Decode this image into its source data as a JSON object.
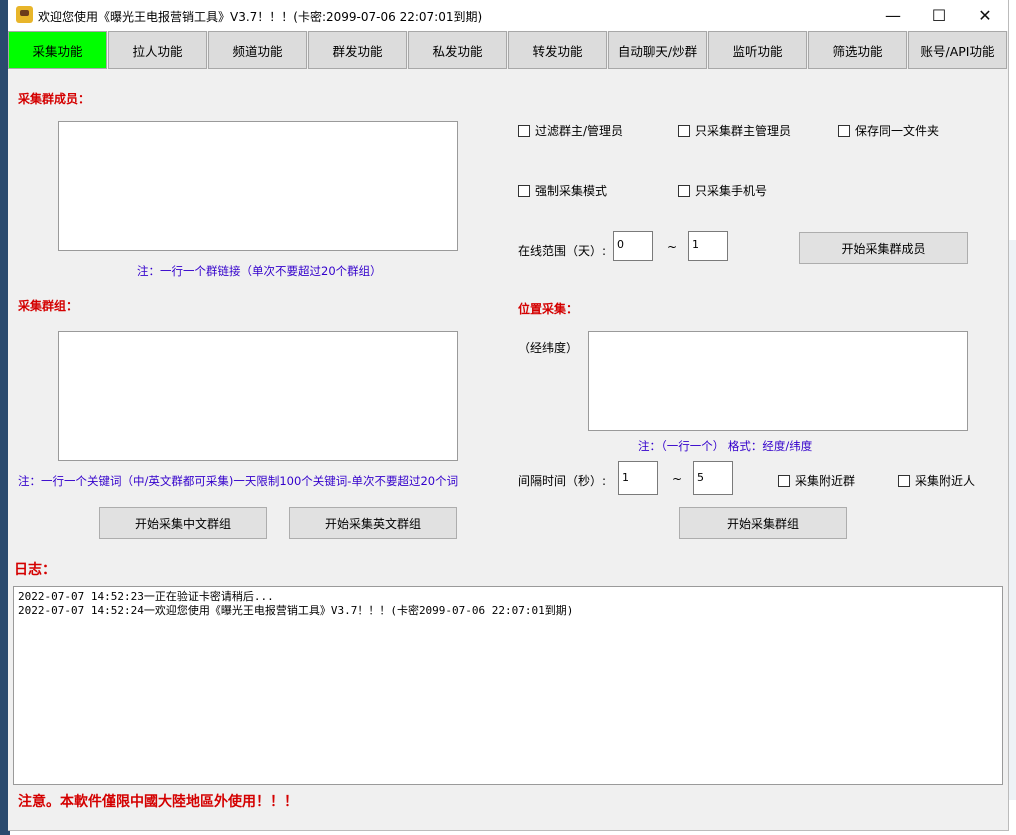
{
  "window": {
    "title": "欢迎您使用《曝光王电报营销工具》V3.7！！！(卡密:2099-07-06 22:07:01到期)",
    "minimize": "—",
    "maximize": "☐",
    "close": "✕"
  },
  "tabs": [
    "采集功能",
    "拉人功能",
    "频道功能",
    "群发功能",
    "私发功能",
    "转发功能",
    "自动聊天/炒群",
    "监听功能",
    "筛选功能",
    "账号/API功能"
  ],
  "colors": {
    "active_tab": "#00ff00",
    "label_red": "#d40000",
    "note_blue": "#3300cc"
  },
  "collect_members": {
    "label": "采集群成员：",
    "note": "注：一行一个群链接（单次不要超过20个群组）",
    "options": [
      "过滤群主/管理员",
      "只采集群主管理员",
      "保存同一文件夹",
      "强制采集模式",
      "只采集手机号"
    ],
    "online_range_label": "在线范围（天）:",
    "range_from": "0",
    "range_sep": "~",
    "range_to": "1",
    "start_button": "开始采集群成员"
  },
  "collect_groups": {
    "label": "采集群组：",
    "note": "注：一行一个关键词（中/英文群都可采集)一天限制100个关键词-单次不要超过20个词",
    "btn_cn": "开始采集中文群组",
    "btn_en": "开始采集英文群组"
  },
  "location": {
    "label": "位置采集：",
    "coord_label": "（经纬度）",
    "note": "注：（一行一个） 格式：经度/纬度",
    "interval_label": "间隔时间（秒）:",
    "interval_from": "1",
    "interval_sep": "~",
    "interval_to": "5",
    "opt_groups": "采集附近群",
    "opt_people": "采集附近人",
    "start_button": "开始采集群组"
  },
  "log": {
    "label": "日志：",
    "lines": [
      "2022-07-07 14:52:23一正在验证卡密请稍后...",
      "2022-07-07 14:52:24一欢迎您使用《曝光王电报营销工具》V3.7！！！(卡密2099-07-06 22:07:01到期)"
    ]
  },
  "footer_warning": "注意。本軟件僅限中國大陸地區外使用！！！"
}
